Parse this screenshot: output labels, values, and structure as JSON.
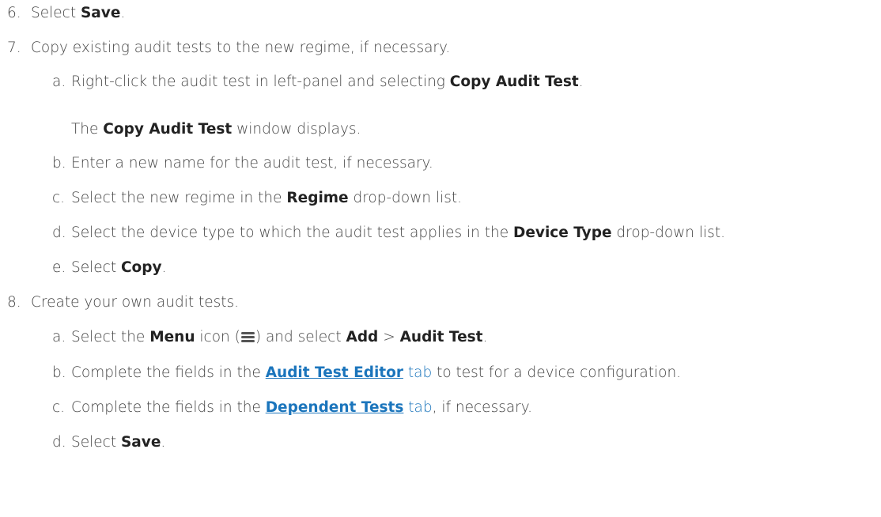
{
  "steps": {
    "s6": {
      "num": "6.",
      "pre": "Select ",
      "bold": "Save",
      "post": "."
    },
    "s7": {
      "num": "7.",
      "text": "Copy existing audit tests to the new regime, if necessary."
    },
    "s7a": {
      "letter": "a.",
      "pre": "Right-click the audit test in left-panel and selecting ",
      "bold": "Copy Audit Test",
      "post": "."
    },
    "s7a_note": {
      "pre": "The ",
      "bold": "Copy Audit Test",
      "post": " window displays."
    },
    "s7b": {
      "letter": "b.",
      "text": "Enter a new name for the audit test, if necessary."
    },
    "s7c": {
      "letter": "c.",
      "pre": "Select the new regime in the ",
      "bold": "Regime",
      "post": " drop-down list."
    },
    "s7d": {
      "letter": "d.",
      "pre": "Select the device type to which the audit test applies in the ",
      "bold": "Device Type",
      "post": " drop-down list."
    },
    "s7e": {
      "letter": "e.",
      "pre": "Select ",
      "bold": "Copy",
      "post": "."
    },
    "s8": {
      "num": "8.",
      "text": "Create your own audit tests."
    },
    "s8a": {
      "letter": "a.",
      "pre": "Select the ",
      "bold1": "Menu",
      "mid1": " icon (",
      "mid2": ") and select ",
      "bold2": "Add",
      "sep": " > ",
      "bold3": "Audit Test",
      "post": "."
    },
    "s8b": {
      "letter": "b.",
      "pre": "Complete the fields in the ",
      "link_bold": "Audit Test Editor",
      "link_tail": " tab",
      "post": " to test for a device configuration."
    },
    "s8c": {
      "letter": "c.",
      "pre": "Complete the fields in the ",
      "link_bold": "Dependent Tests",
      "link_tail": " tab",
      "post": ", if necessary."
    },
    "s8d": {
      "letter": "d.",
      "pre": "Select ",
      "bold": "Save",
      "post": "."
    }
  },
  "colors": {
    "text": "#444444",
    "bold": "#222222",
    "link": "#1b75bc"
  },
  "icons": {
    "menu": "hamburger-menu-icon"
  }
}
